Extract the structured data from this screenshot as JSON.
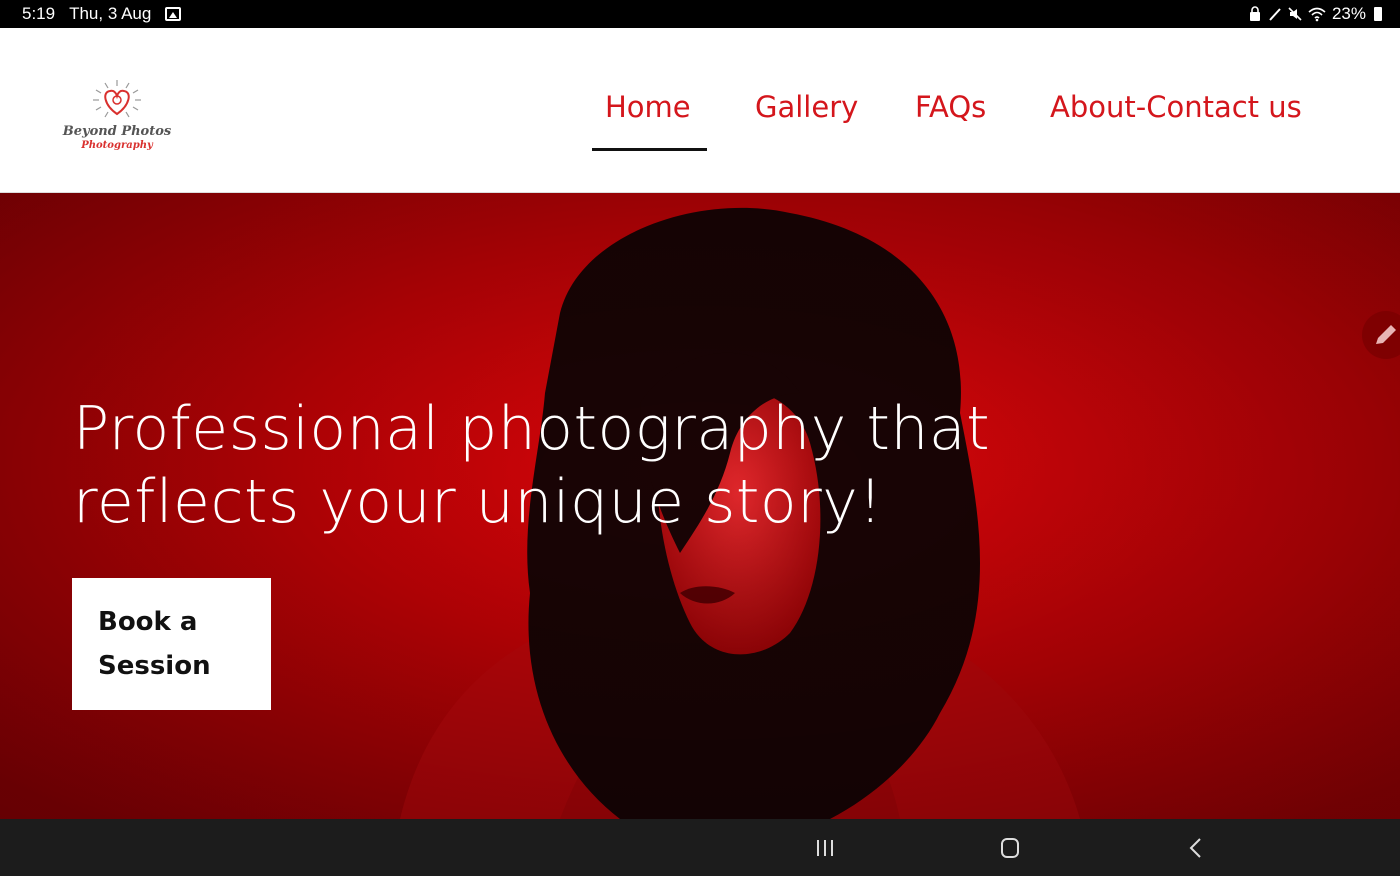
{
  "status_bar": {
    "time": "5:19",
    "date": "Thu, 3 Aug",
    "battery": "23%",
    "icons": [
      "gallery-icon",
      "lock-icon",
      "pen-icon",
      "mute-icon",
      "wifi-icon",
      "battery-icon"
    ]
  },
  "header": {
    "logo": {
      "name": "Beyond Photos",
      "tagline": "Photography"
    },
    "nav": [
      {
        "label": "Home",
        "active": true
      },
      {
        "label": "Gallery",
        "active": false
      },
      {
        "label": "FAQs",
        "active": false
      },
      {
        "label": "About-Contact us",
        "active": false
      }
    ]
  },
  "hero": {
    "title_line1": "Professional photography that",
    "title_line2": "reflects your unique story!",
    "cta_line1": "Book a",
    "cta_line2": "Session",
    "edit_icon": "pencil-icon"
  },
  "system_nav": {
    "icons": [
      "recent-apps-icon",
      "home-icon",
      "back-icon"
    ]
  },
  "colors": {
    "brand_red": "#d4161c",
    "hero_red": "#c90206",
    "nav_underline": "#111111"
  }
}
